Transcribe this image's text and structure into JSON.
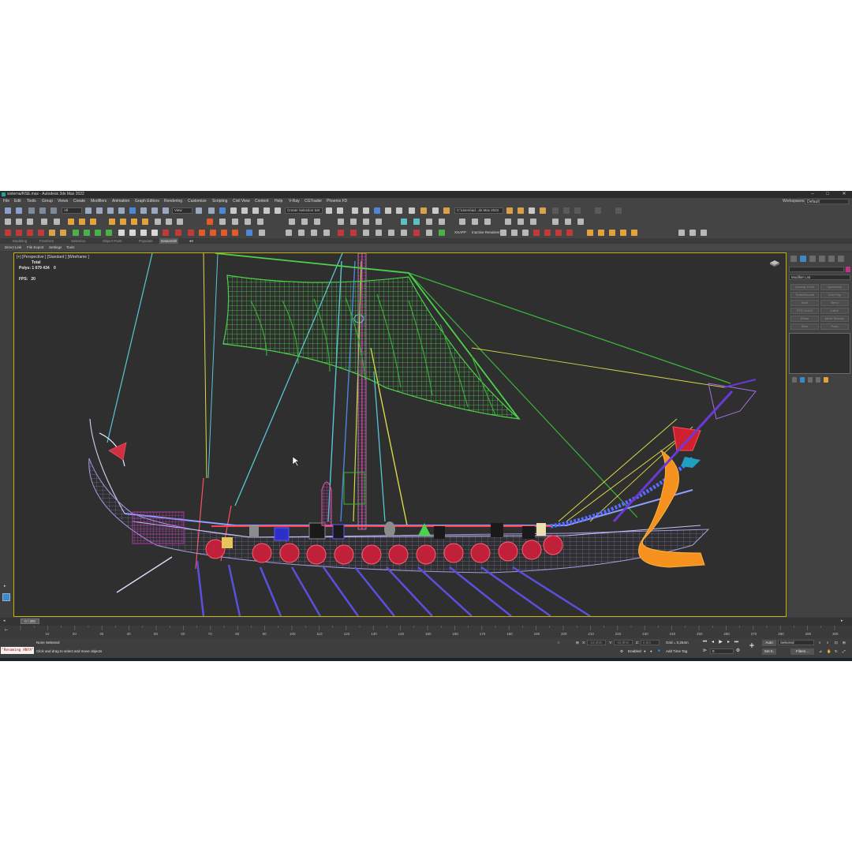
{
  "window": {
    "title": "sixterna/RSE.max - Autodesk 3ds Max 2022",
    "minimize_glyph": "–",
    "maximize_glyph": "□",
    "close_glyph": "✕"
  },
  "menu": {
    "items": [
      "File",
      "Edit",
      "Tools",
      "Group",
      "Views",
      "Create",
      "Modifiers",
      "Animation",
      "Graph Editors",
      "Rendering",
      "Customize",
      "Scripting",
      "Civil View",
      "Content",
      "Help",
      "V-Ray",
      "CGTrader",
      "Phoenix FD"
    ],
    "workspace_label": "Workspaces:",
    "workspace_value": "Default"
  },
  "toolbar": {
    "selection_filter": "All",
    "ref_coord": "View",
    "named_selection": "Create Selection Set",
    "project_path": "C:\\Users\\ad...ds Max 2022",
    "renderer_label": "XSAPP",
    "active_renderer": "Inactive Renderer"
  },
  "ribbon": {
    "tabs": [
      "Modeling",
      "Freeform",
      "Selection",
      "Object Paint",
      "Populate",
      "Datasmith"
    ],
    "active_tab": "Datasmith",
    "subitems": [
      "Direct Link",
      "File Export",
      "Settings",
      "Tools"
    ]
  },
  "viewport": {
    "label": "[+] [Perspective ] [Standard ] [Wireframe ]",
    "stats_total_label": "Total",
    "polys_label": "Polys:",
    "polys_value": "1 679 434",
    "polys_selected": "0",
    "fps_label": "FPS:",
    "fps_value": "20"
  },
  "command_panel": {
    "modifier_list_label": "Modifier List",
    "modifier_buttons": [
      "Unwrap UVW",
      "Symmetry",
      "TurboSmooth",
      "Edit Poly",
      "Shell",
      "Bend",
      "FFD 4x4x4",
      "Lathe",
      "Relax",
      "Mesh Smooth",
      "Slice",
      "Push"
    ],
    "object_color": "#c2338a"
  },
  "timeline": {
    "slider_label": "0 / 300",
    "ticks": [
      10,
      20,
      30,
      40,
      50,
      60,
      70,
      80,
      90,
      100,
      110,
      120,
      130,
      140,
      150,
      160,
      170,
      180,
      190,
      200,
      210,
      220,
      230,
      240,
      250,
      260,
      270,
      280,
      290,
      300
    ]
  },
  "status": {
    "maxscript_text": "\"Renaming ANYA\"",
    "selection_text": "None Selected",
    "prompt_text": "Click and drag to select and move objects",
    "x_label": "X:",
    "x_value": "-10,4hm",
    "y_label": "Y:",
    "y_value": "-15,9hm",
    "z_label": "Z:",
    "z_value": "0,0m",
    "grid_text": "Grid = 0,254m",
    "enabled_label": "Enabled:",
    "add_time_tag": "Add Time Tag",
    "auto_key": "Auto",
    "set_key": "Set K.",
    "key_filter_value": "Selected",
    "key_filters_btn": "Filters...",
    "frame_value": "0"
  }
}
